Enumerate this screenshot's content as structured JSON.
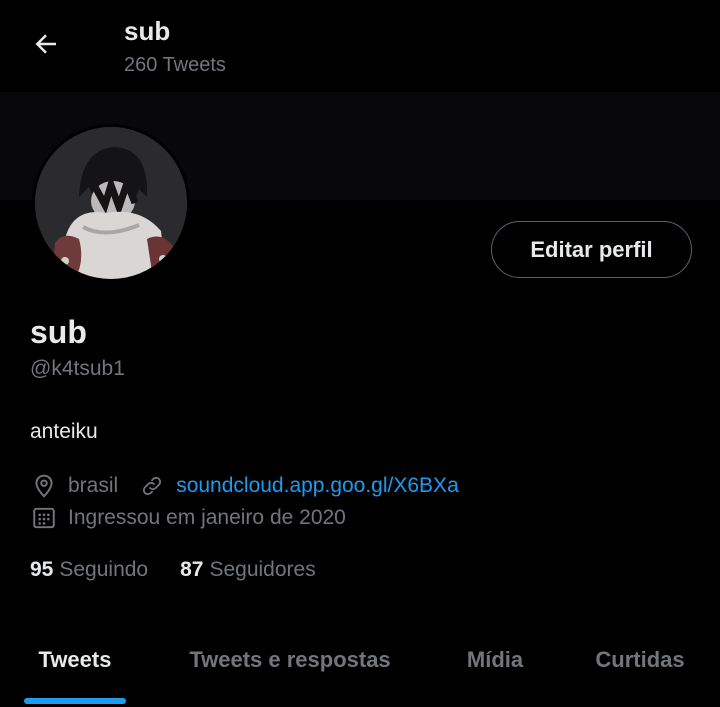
{
  "header": {
    "title": "sub",
    "subtitle": "260 Tweets",
    "back_icon": "arrow-left-icon"
  },
  "profile": {
    "edit_label": "Editar perfil",
    "display_name": "sub",
    "handle": "@k4tsub1",
    "bio": "anteiku",
    "location": "brasil",
    "link": "soundcloud.app.goo.gl/X6BXa",
    "joined": "Ingressou em janeiro de 2020",
    "following_count": "95",
    "following_label": "Seguindo",
    "followers_count": "87",
    "followers_label": "Seguidores"
  },
  "tabs": [
    {
      "label": "Tweets",
      "active": true
    },
    {
      "label": "Tweets e respostas",
      "active": false
    },
    {
      "label": "Mídia",
      "active": false
    },
    {
      "label": "Curtidas",
      "active": false
    }
  ],
  "colors": {
    "background": "#000000",
    "text_primary": "#e7e9ea",
    "text_secondary": "#71767b",
    "accent": "#1d9bf0"
  }
}
